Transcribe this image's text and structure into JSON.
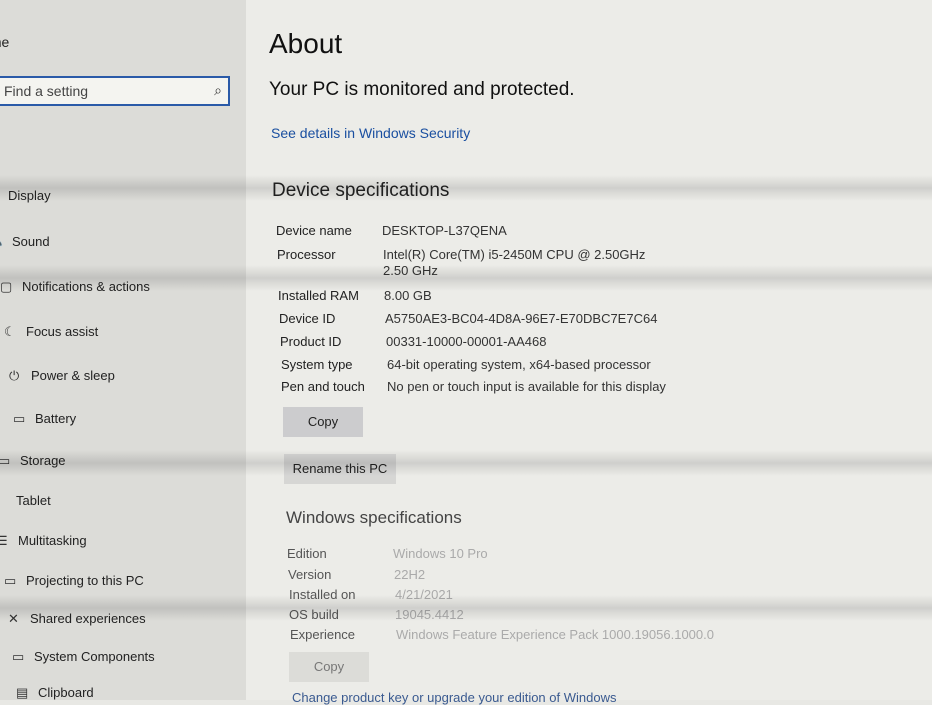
{
  "sidebar": {
    "home": "Home",
    "search_placeholder": "Find a setting",
    "items": [
      {
        "label": "Display",
        "icon": "display-icon"
      },
      {
        "label": "Sound",
        "icon": "sound-icon"
      },
      {
        "label": "Notifications & actions",
        "icon": "notifications-icon"
      },
      {
        "label": "Focus assist",
        "icon": "focus-assist-icon"
      },
      {
        "label": "Power & sleep",
        "icon": "power-icon"
      },
      {
        "label": "Battery",
        "icon": "battery-icon"
      },
      {
        "label": "Storage",
        "icon": "storage-icon"
      },
      {
        "label": "Tablet",
        "icon": "tablet-icon"
      },
      {
        "label": "Multitasking",
        "icon": "multitasking-icon"
      },
      {
        "label": "Projecting to this PC",
        "icon": "projecting-icon"
      },
      {
        "label": "Shared experiences",
        "icon": "shared-icon"
      },
      {
        "label": "System Components",
        "icon": "components-icon"
      },
      {
        "label": "Clipboard",
        "icon": "clipboard-icon"
      }
    ]
  },
  "main": {
    "title": "About",
    "protection": "Your PC is monitored and protected.",
    "security_link": "See details in Windows Security",
    "device_specs": {
      "heading": "Device specifications",
      "rows": [
        {
          "k": "Device name",
          "v": "DESKTOP-L37QENA"
        },
        {
          "k": "Processor",
          "v": "Intel(R) Core(TM) i5-2450M CPU @ 2.50GHz   2.50 GHz"
        },
        {
          "k": "Installed RAM",
          "v": "8.00 GB"
        },
        {
          "k": "Device ID",
          "v": "A5750AE3-BC04-4D8A-96E7-E70DBC7E7C64"
        },
        {
          "k": "Product ID",
          "v": "00331-10000-00001-AA468"
        },
        {
          "k": "System type",
          "v": "64-bit operating system, x64-based processor"
        },
        {
          "k": "Pen and touch",
          "v": "No pen or touch input is available for this display"
        }
      ],
      "copy": "Copy",
      "rename": "Rename this PC"
    },
    "windows_specs": {
      "heading": "Windows specifications",
      "rows": [
        {
          "k": "Edition",
          "v": "Windows 10 Pro"
        },
        {
          "k": "Version",
          "v": "22H2"
        },
        {
          "k": "Installed on",
          "v": "4/21/2021"
        },
        {
          "k": "OS build",
          "v": "19045.4412"
        },
        {
          "k": "Experience",
          "v": "Windows Feature Experience Pack 1000.19056.1000.0"
        }
      ],
      "copy": "Copy",
      "change_key": "Change product key or upgrade your edition of Windows"
    }
  }
}
